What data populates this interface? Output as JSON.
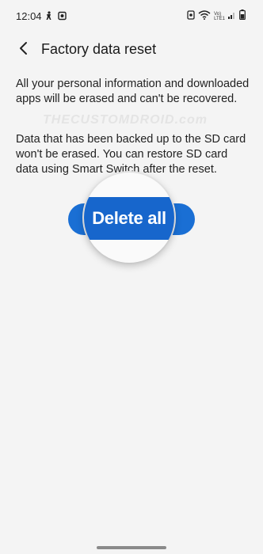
{
  "status_bar": {
    "time": "12:04",
    "left_icons": [
      "accessibility-icon",
      "photo-icon"
    ],
    "right_icons": [
      "alarm-icon",
      "wifi-icon",
      "signal-icon",
      "battery-icon"
    ],
    "volte_line1": "Vo)",
    "volte_line2": "LTE1"
  },
  "header": {
    "back_icon": "chevron-left-icon",
    "title": "Factory data reset"
  },
  "content": {
    "paragraph_1": "All your personal information and downloaded apps will be erased and can't be recovered.",
    "paragraph_2": "Data that has been backed up to the SD card won't be erased. You can restore SD card data using Smart Switch after the reset.",
    "watermark": "THECUSTOMDROID.com"
  },
  "actions": {
    "delete_all_label": "Delete all",
    "accent_color": "#1a6fd4"
  },
  "navigation": {
    "handle_icon": "gesture-handle"
  }
}
